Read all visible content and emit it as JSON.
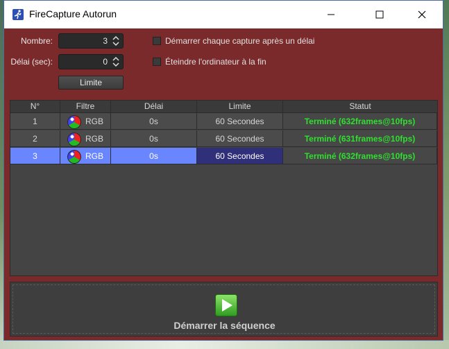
{
  "window": {
    "title": "FireCapture Autorun",
    "accent_color": "#7a2a2a"
  },
  "controls": {
    "nombre_label": "Nombre:",
    "nombre_value": "3",
    "delai_label": "Délai (sec):",
    "delai_value": "0",
    "limite_button": "Limite",
    "check_delay_label": "Démarrer chaque capture après un délai",
    "check_shutdown_label": "Éteindre l'ordinateur à la fin"
  },
  "table": {
    "columns": [
      "N°",
      "Filtre",
      "Délai",
      "Limite",
      "Statut"
    ],
    "rows": [
      {
        "n": "1",
        "filtre": "RGB",
        "delai": "0s",
        "limite": "60 Secondes",
        "statut": "Terminé  (632frames@10fps)"
      },
      {
        "n": "2",
        "filtre": "RGB",
        "delai": "0s",
        "limite": "60 Secondes",
        "statut": "Terminé  (631frames@10fps)"
      },
      {
        "n": "3",
        "filtre": "RGB",
        "delai": "0s",
        "limite": "60 Secondes",
        "statut": "Terminé  (632frames@10fps)"
      }
    ],
    "selected_row": 3,
    "status_color": "#2fe02f",
    "selection_color": "#6a86ff"
  },
  "start": {
    "label": "Démarrer la séquence",
    "icon": "play-icon"
  },
  "icons": {
    "app": "running-man-icon",
    "minimize": "minimize-icon",
    "maximize": "maximize-icon",
    "close": "close-icon",
    "filter": "rgb-ball-icon"
  }
}
